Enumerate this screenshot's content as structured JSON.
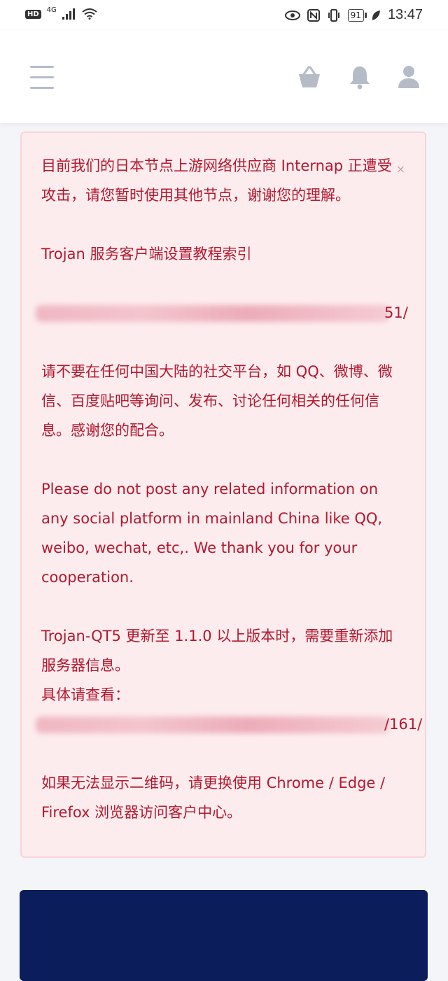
{
  "status_bar": {
    "hd": "HD",
    "signal": "4G",
    "battery": "91",
    "time": "13:47"
  },
  "header": {
    "menu_icon": "hamburger-menu-icon",
    "basket_icon": "basket-icon",
    "bell_icon": "bell-icon",
    "user_icon": "user-icon"
  },
  "notice": {
    "close_label": "×",
    "p1": "目前我们的日本节点上游网络供应商 Internap 正遭受攻击，请您暂时使用其他节点，谢谢您的理解。",
    "p2": "Trojan 服务客户端设置教程索引",
    "link1_tail": "51/",
    "p3": "请不要在任何中国大陆的社交平台，如 QQ、微博、微信、百度贴吧等询问、发布、讨论任何相关的任何信息。感谢您的配合。",
    "p4": "Please do not post any related information on any social platform in mainland China like QQ, weibo, wechat, etc,. We thank you for your cooperation.",
    "p5": "Trojan-QT5 更新至 1.1.0 以上版本时，需要重新添加服务器信息。",
    "p6": "具体请查看：",
    "link2_tail": "/161/",
    "p7": "如果无法显示二维码，请更换使用 Chrome / Edge / Firefox 浏览器访问客户中心。"
  },
  "colors": {
    "alert_bg": "#fdecee",
    "alert_border": "#fad3d8",
    "alert_text": "#b3182e",
    "dark_card": "#0b1d5a",
    "icon_gray": "#b6bcc7"
  }
}
